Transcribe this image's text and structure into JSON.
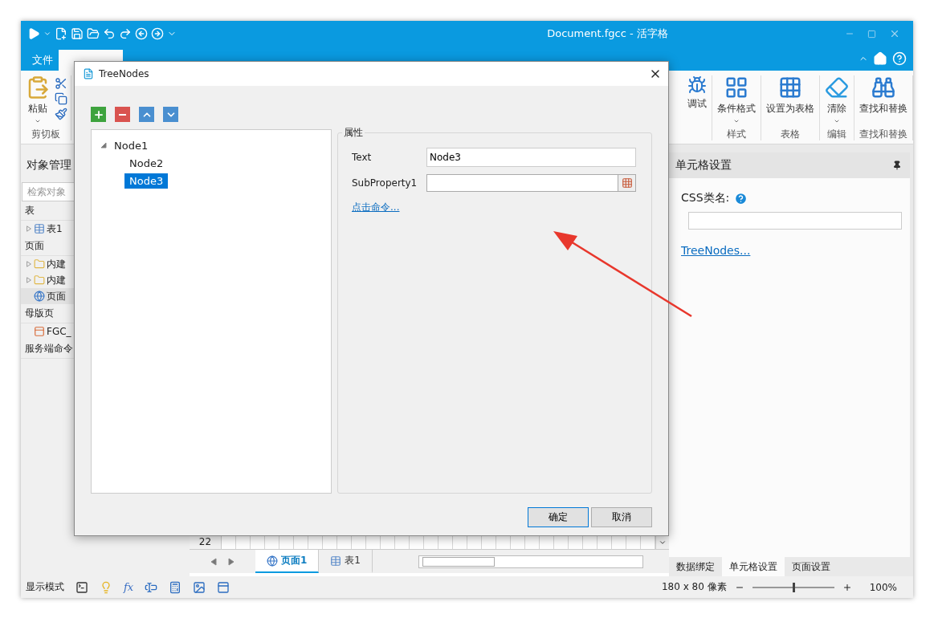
{
  "window": {
    "title": "Document.fgcc - 活字格"
  },
  "ribbon": {
    "tabs": [
      {
        "label": "文件",
        "selected": false
      }
    ],
    "clipboard": {
      "label": "剪切板",
      "paste": "粘贴"
    },
    "groups": [
      {
        "buttons": [
          {
            "label": "调试",
            "kind": "debug",
            "dropdown": false
          }
        ]
      },
      {
        "label": "样式",
        "buttons": [
          {
            "label": "条件格式",
            "kind": "conditional",
            "dropdown": true
          }
        ]
      },
      {
        "label": "表格",
        "buttons": [
          {
            "label": "设置为表格",
            "kind": "table",
            "dropdown": false
          }
        ]
      },
      {
        "label": "编辑",
        "buttons": [
          {
            "label": "清除",
            "kind": "eraser",
            "dropdown": true
          }
        ]
      },
      {
        "label": "查找和替换",
        "buttons": [
          {
            "label": "查找和替换",
            "kind": "binoculars",
            "dropdown": false
          }
        ]
      }
    ]
  },
  "object_panel": {
    "title": "对象管理",
    "search_placeholder": "检索对象",
    "sections": [
      {
        "label": "表",
        "items": [
          {
            "label": "表1",
            "kind": "table",
            "expandable": true,
            "selected": false
          }
        ]
      },
      {
        "label": "页面",
        "items": [
          {
            "label": "内建",
            "kind": "folder",
            "expandable": true,
            "selected": false
          },
          {
            "label": "内建",
            "kind": "folder",
            "expandable": true,
            "selected": false
          },
          {
            "label": "页面",
            "kind": "page",
            "expandable": false,
            "selected": true
          }
        ]
      },
      {
        "label": "母版页",
        "items": [
          {
            "label": "FGC_",
            "kind": "master",
            "expandable": false,
            "selected": false
          }
        ]
      },
      {
        "label": "服务端命令"
      }
    ]
  },
  "sheet": {
    "row_number": "22",
    "tabs": [
      {
        "label": "页面1",
        "kind": "page",
        "selected": true
      },
      {
        "label": "表1",
        "kind": "table",
        "selected": false
      }
    ]
  },
  "cell_settings": {
    "title": "单元格设置",
    "css_label": "CSS类名:",
    "link": "TreeNodes...",
    "tabs": [
      {
        "label": "数据绑定",
        "selected": false
      },
      {
        "label": "单元格设置",
        "selected": true
      },
      {
        "label": "页面设置",
        "selected": false
      }
    ]
  },
  "dialog": {
    "title": "TreeNodes",
    "toolbar": [
      {
        "kind": "add"
      },
      {
        "kind": "remove"
      },
      {
        "kind": "up"
      },
      {
        "kind": "down"
      }
    ],
    "tree": [
      {
        "label": "Node1",
        "expanded": true,
        "selected": false,
        "children": [
          {
            "label": "Node2",
            "selected": false
          },
          {
            "label": "Node3",
            "selected": true
          }
        ]
      }
    ],
    "properties": {
      "legend": "属性",
      "fields": [
        {
          "label": "Text",
          "value": "Node3",
          "kind": "text"
        },
        {
          "label": "SubProperty1",
          "kind": "picker"
        }
      ],
      "link": "点击命令..."
    },
    "buttons": [
      {
        "label": "确定",
        "primary": true
      },
      {
        "label": "取消",
        "primary": false
      }
    ]
  },
  "status_bar": {
    "label": "显示模式",
    "tools": [
      {
        "kind": "terminal"
      },
      {
        "kind": "marker"
      },
      {
        "kind": "formula",
        "label": "fx"
      },
      {
        "kind": "textbox"
      },
      {
        "kind": "calc"
      },
      {
        "kind": "image"
      },
      {
        "kind": "form"
      }
    ],
    "size": "180 x 80 像素",
    "zoom": {
      "level": 0.5,
      "reading": "100%"
    }
  }
}
